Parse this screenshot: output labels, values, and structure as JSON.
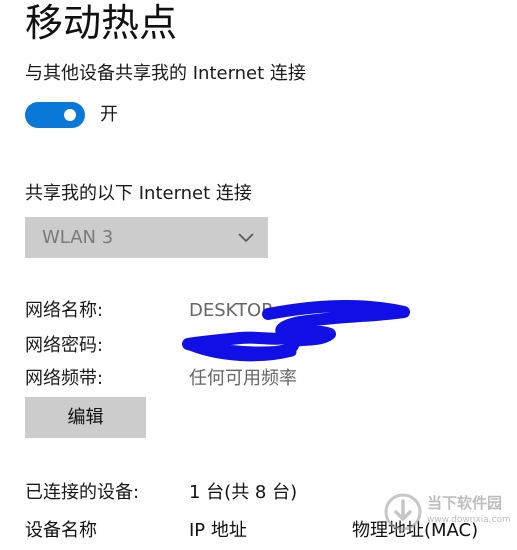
{
  "page_title": "移动热点",
  "share_label": "与其他设备共享我的 Internet 连接",
  "toggle": {
    "state_label": "开",
    "on": true,
    "color": "#0a78d7"
  },
  "share_from": {
    "label": "共享我的以下 Internet 连接",
    "selected": "WLAN 3"
  },
  "network_info": {
    "name_label": "网络名称:",
    "name_value": "DESKTOP",
    "password_label": "网络密码:",
    "band_label": "网络频带:",
    "band_value": "任何可用频率"
  },
  "edit_button": "编辑",
  "connected": {
    "label": "已连接的设备:",
    "value": "1 台(共 8 台)"
  },
  "columns": [
    "设备名称",
    "IP 地址",
    "物理地址(MAC)"
  ],
  "watermark": {
    "line1": "当下软件园",
    "line2": "www.downxia.com"
  },
  "colors": {
    "redaction": "#1010e6",
    "accent": "#0a78d7"
  }
}
